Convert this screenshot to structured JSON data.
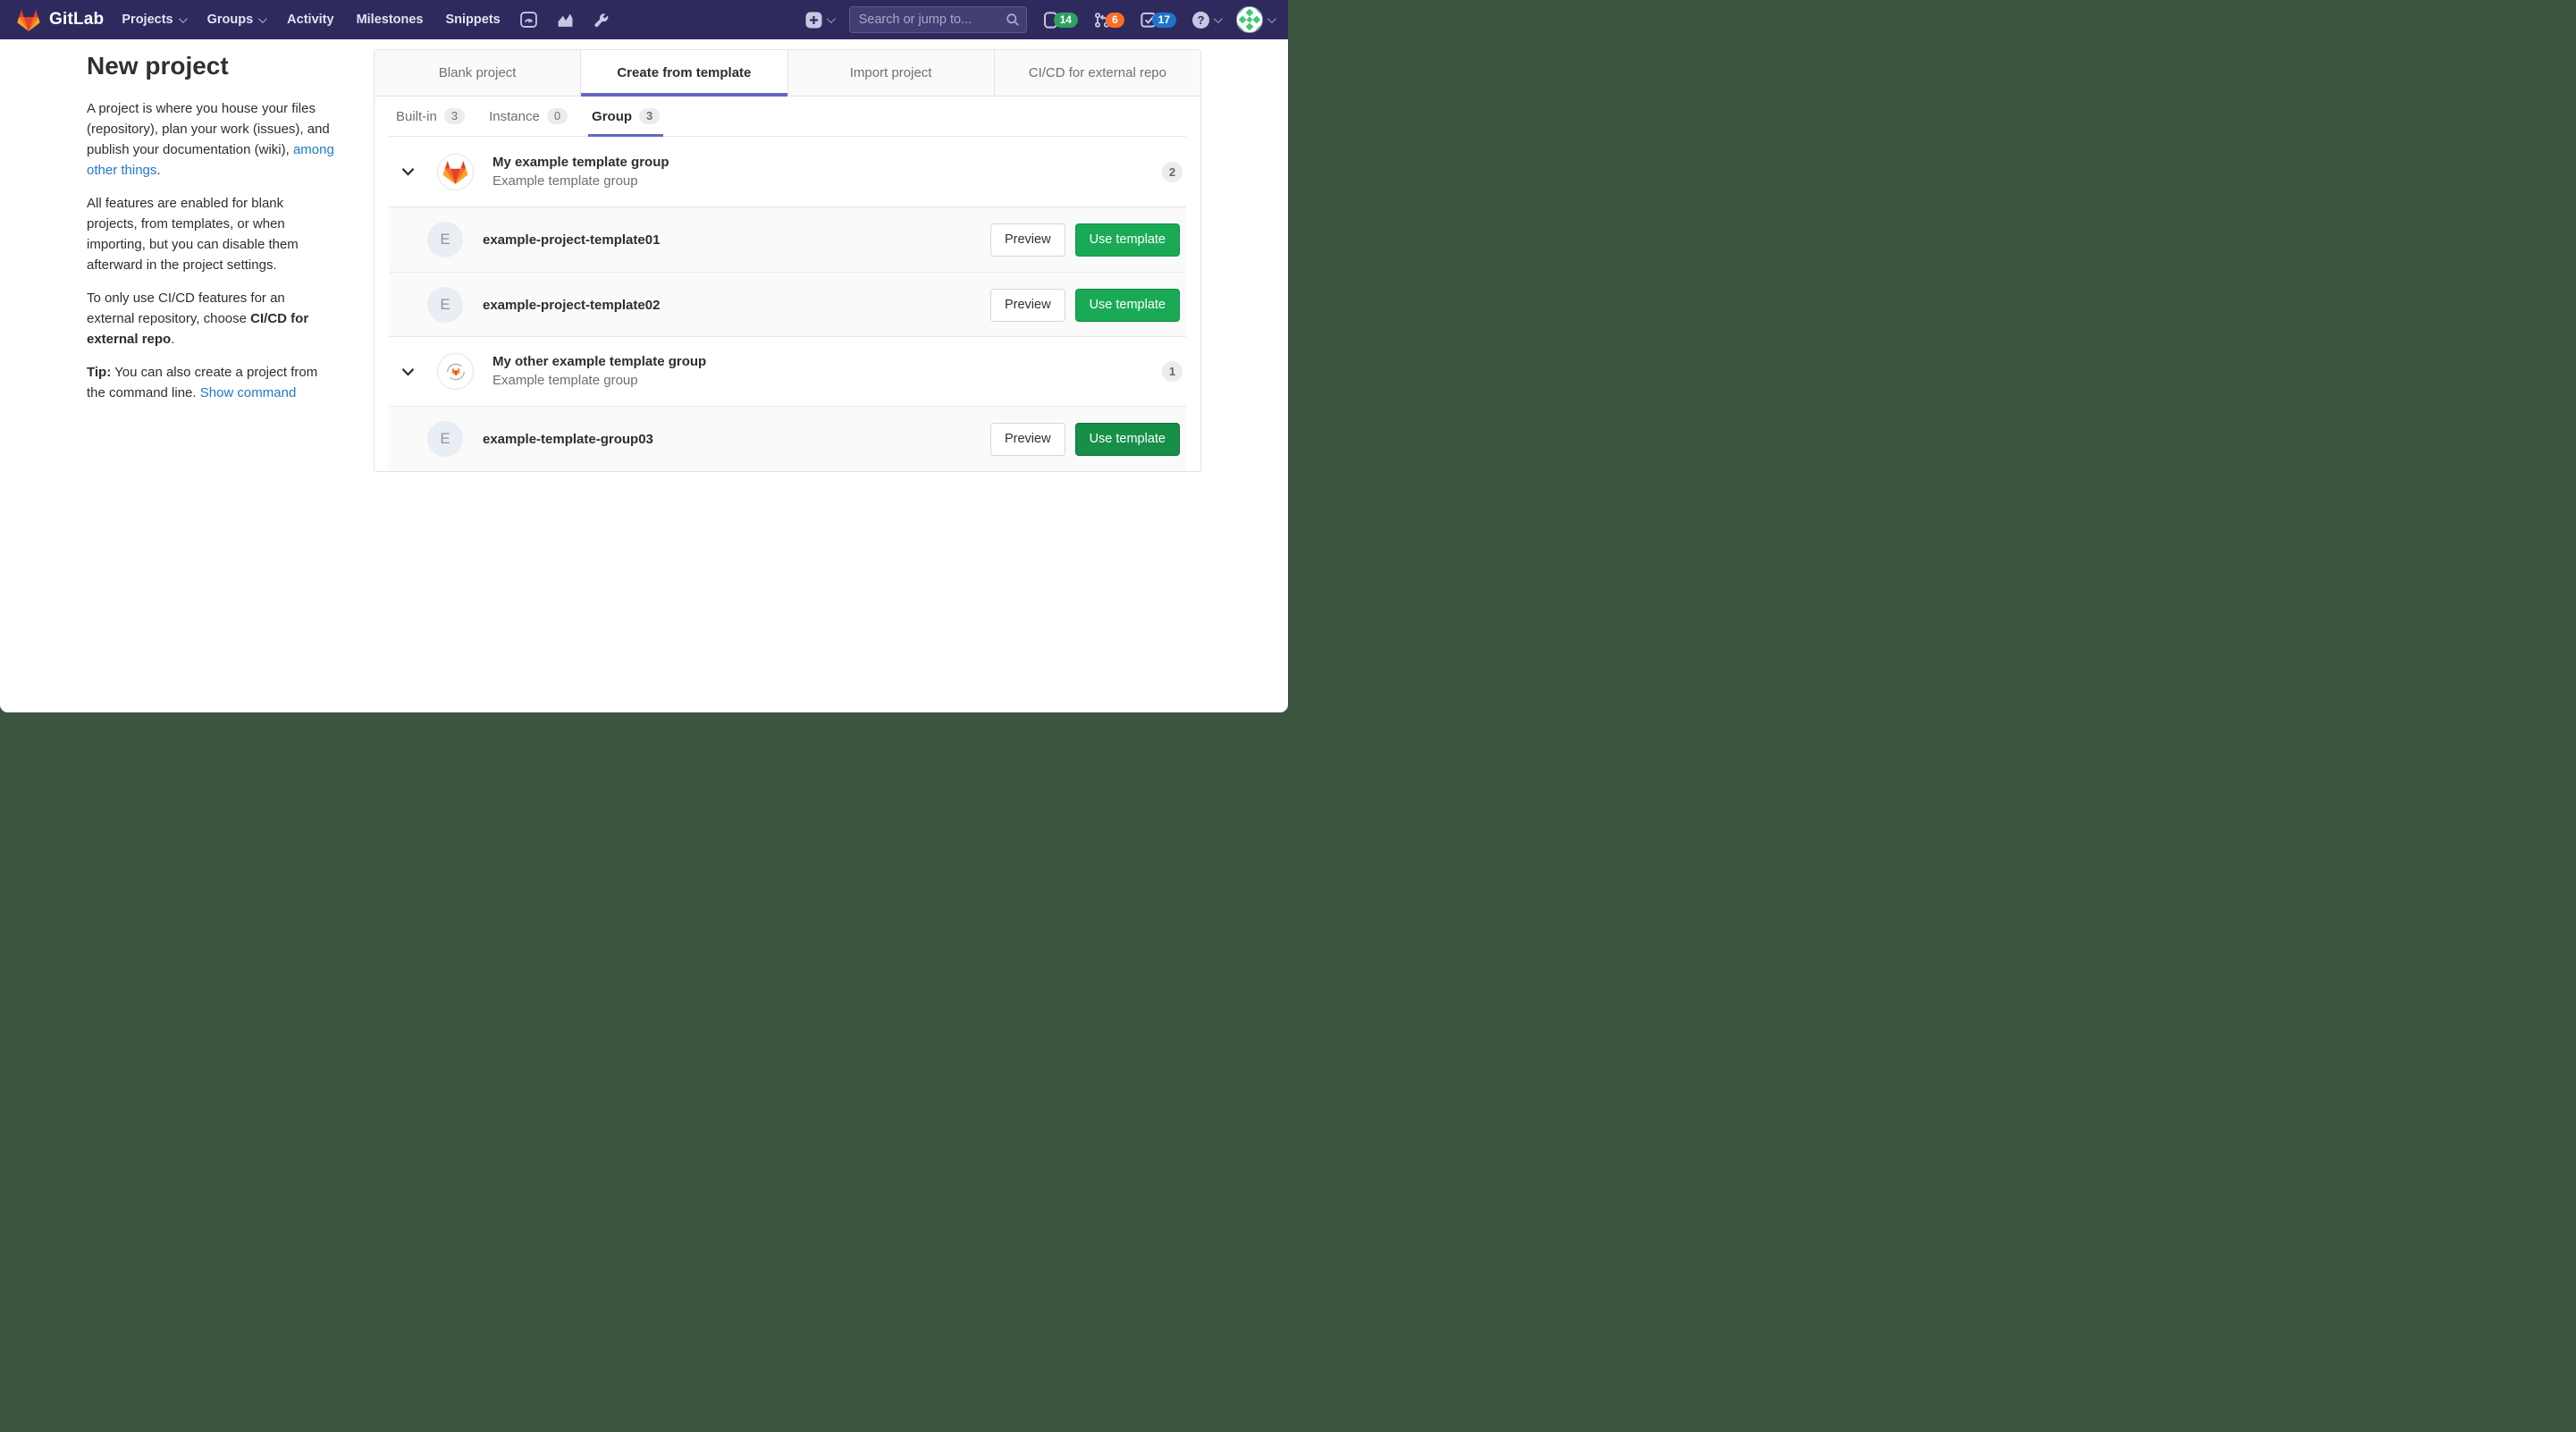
{
  "navbar": {
    "brand": "GitLab",
    "links": [
      {
        "label": "Projects",
        "chevron": true
      },
      {
        "label": "Groups",
        "chevron": true
      },
      {
        "label": "Activity"
      },
      {
        "label": "Milestones"
      },
      {
        "label": "Snippets"
      }
    ],
    "search_placeholder": "Search or jump to...",
    "issues_count": "14",
    "merge_requests_count": "6",
    "todos_count": "17",
    "help_glyph": "?"
  },
  "sidebar": {
    "title": "New project",
    "p1_text": "A project is where you house your files (repository), plan your work (issues), and publish your documentation (wiki), ",
    "p1_link": "among other things",
    "p1_end": ".",
    "p2": "All features are enabled for blank projects, from templates, or when importing, but you can disable them afterward in the project settings.",
    "p3_text": "To only use CI/CD features for an external repository, choose ",
    "p3_bold": "CI/CD for external repo",
    "p3_end": ".",
    "p4_bold": "Tip:",
    "p4_text": " You can also create a project from the command line. ",
    "p4_link": "Show command"
  },
  "tabs": [
    {
      "label": "Blank project"
    },
    {
      "label": "Create from template",
      "active": true
    },
    {
      "label": "Import project"
    },
    {
      "label": "CI/CD for external repo"
    }
  ],
  "subtabs": [
    {
      "label": "Built-in",
      "count": "3"
    },
    {
      "label": "Instance",
      "count": "0"
    },
    {
      "label": "Group",
      "count": "3",
      "active": true
    }
  ],
  "buttons": {
    "preview": "Preview",
    "use_template": "Use template"
  },
  "groups": [
    {
      "name": "My example template group",
      "description": "Example template group",
      "count": "2",
      "templates": [
        {
          "initial": "E",
          "name": "example-project-template01"
        },
        {
          "initial": "E",
          "name": "example-project-template02"
        }
      ]
    },
    {
      "name": "My other example template group",
      "description": "Example template group",
      "count": "1",
      "templates": [
        {
          "initial": "E",
          "name": "example-template-group03"
        }
      ]
    }
  ],
  "colors": {
    "navbar_bg": "#2e2a5e",
    "accent_indigo": "#6666c4",
    "link_blue": "#1f78d1",
    "button_green": "#1aaa55",
    "badge_green": "#2da160",
    "badge_orange": "#fb6e23",
    "badge_blue": "#1f75cb",
    "desktop_green": "#3c5540"
  }
}
